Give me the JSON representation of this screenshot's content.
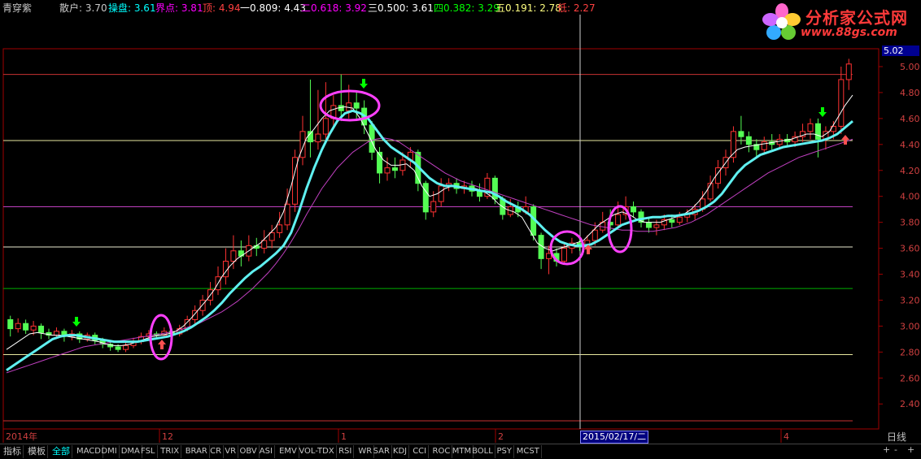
{
  "top_bar": {
    "title": "青穿紫",
    "items": [
      {
        "label": "散户:",
        "value": "3.70",
        "color": "#c8c8c8"
      },
      {
        "label": "操盘:",
        "value": "3.61",
        "color": "#00ffff"
      },
      {
        "label": "界点:",
        "value": "3.81",
        "color": "#ff00ff"
      },
      {
        "label": "顶:",
        "value": "4.94",
        "color": "#ff4040"
      },
      {
        "label": "一0.809:",
        "value": "4.43",
        "color": "#ffffff"
      },
      {
        "label": "二0.618:",
        "value": "3.92",
        "color": "#ff00ff"
      },
      {
        "label": "三0.500:",
        "value": "3.61",
        "color": "#ffffff"
      },
      {
        "label": "四0.382:",
        "value": "3.29",
        "color": "#00ff00"
      },
      {
        "label": "五0.191:",
        "value": "2.78",
        "color": "#ffff80"
      },
      {
        "label": "低:",
        "value": "2.27",
        "color": "#ff4040"
      }
    ]
  },
  "logo": {
    "name": "分析家公式网",
    "url": "www.88gs.com"
  },
  "price_box": "5.02",
  "crosshair_date": "2015/02/17/二",
  "period": "日线",
  "x_labels": [
    "2014年",
    "12",
    "1",
    "2",
    "4"
  ],
  "y_ticks": [
    "5.00",
    "4.80",
    "4.60",
    "4.40",
    "4.20",
    "4.00",
    "3.80",
    "3.60",
    "3.40",
    "3.20",
    "3.00",
    "2.80",
    "2.60",
    "2.40"
  ],
  "tabs": [
    "指标",
    "模板",
    "全部",
    "MACD",
    "DMI",
    "DMA",
    "FSL",
    "TRIX",
    "BRAR",
    "CR",
    "VR",
    "OBV",
    "ASI",
    "EMV",
    "VOL-TDX",
    "RSI",
    "WR",
    "SAR",
    "KDJ",
    "CCI",
    "ROC",
    "MTM",
    "BOLL",
    "PSY",
    "MCST"
  ],
  "scroll_buttons": [
    "+",
    "-",
    "+"
  ],
  "colors": {
    "up": "#ff3232",
    "down": "#54fcfc",
    "green": "#00a000",
    "cyan_line": "#5ff0f0",
    "magenta_line": "#c040c0",
    "axis": "#a00000"
  },
  "chart_data": {
    "type": "candlestick",
    "y_range": [
      2.27,
      5.05
    ],
    "horizontal_levels": [
      {
        "value": 4.94,
        "color": "#c83232"
      },
      {
        "value": 4.43,
        "color": "#e8e8a0"
      },
      {
        "value": 3.92,
        "color": "#c040c0"
      },
      {
        "value": 3.61,
        "color": "#e8e8d0"
      },
      {
        "value": 3.29,
        "color": "#00b000"
      },
      {
        "value": 2.78,
        "color": "#e8e8a0"
      },
      {
        "value": 2.27,
        "color": "#c83232"
      }
    ],
    "candles": [
      [
        3.05,
        2.98,
        3.08,
        2.92
      ],
      [
        2.98,
        3.02,
        3.06,
        2.95
      ],
      [
        3.02,
        2.97,
        3.05,
        2.94
      ],
      [
        2.97,
        3.0,
        3.04,
        2.93
      ],
      [
        3.0,
        2.95,
        3.02,
        2.9
      ],
      [
        2.95,
        2.93,
        2.98,
        2.9
      ],
      [
        2.93,
        2.96,
        2.99,
        2.9
      ],
      [
        2.96,
        2.92,
        2.98,
        2.88
      ],
      [
        2.92,
        2.94,
        2.97,
        2.89
      ],
      [
        2.94,
        2.9,
        2.96,
        2.87
      ],
      [
        2.9,
        2.93,
        2.95,
        2.88
      ],
      [
        2.93,
        2.89,
        2.95,
        2.86
      ],
      [
        2.89,
        2.86,
        2.91,
        2.83
      ],
      [
        2.86,
        2.84,
        2.88,
        2.81
      ],
      [
        2.84,
        2.82,
        2.86,
        2.8
      ],
      [
        2.82,
        2.85,
        2.88,
        2.8
      ],
      [
        2.85,
        2.88,
        2.91,
        2.83
      ],
      [
        2.88,
        2.92,
        2.95,
        2.86
      ],
      [
        2.92,
        2.94,
        2.97,
        2.9
      ],
      [
        2.94,
        2.93,
        2.96,
        2.91
      ],
      [
        2.93,
        2.96,
        2.99,
        2.91
      ],
      [
        2.96,
        2.94,
        2.98,
        2.92
      ],
      [
        2.94,
        2.98,
        3.01,
        2.92
      ],
      [
        2.98,
        3.05,
        3.08,
        2.96
      ],
      [
        3.05,
        3.12,
        3.16,
        3.02
      ],
      [
        3.12,
        3.2,
        3.24,
        3.08
      ],
      [
        3.2,
        3.28,
        3.34,
        3.16
      ],
      [
        3.28,
        3.38,
        3.46,
        3.24
      ],
      [
        3.38,
        3.5,
        3.6,
        3.32
      ],
      [
        3.5,
        3.58,
        3.7,
        3.44
      ],
      [
        3.58,
        3.54,
        3.66,
        3.46
      ],
      [
        3.54,
        3.62,
        3.7,
        3.5
      ],
      [
        3.62,
        3.6,
        3.68,
        3.54
      ],
      [
        3.6,
        3.66,
        3.74,
        3.56
      ],
      [
        3.66,
        3.72,
        3.78,
        3.6
      ],
      [
        3.72,
        3.78,
        3.88,
        3.68
      ],
      [
        3.78,
        3.94,
        4.06,
        3.74
      ],
      [
        3.94,
        4.3,
        4.36,
        3.88
      ],
      [
        4.3,
        4.5,
        4.62,
        4.24
      ],
      [
        4.5,
        4.42,
        4.9,
        4.3
      ],
      [
        4.42,
        4.48,
        4.82,
        4.36
      ],
      [
        4.48,
        4.6,
        4.88,
        4.44
      ],
      [
        4.6,
        4.7,
        4.78,
        4.52
      ],
      [
        4.7,
        4.66,
        4.94,
        4.58
      ],
      [
        4.66,
        4.72,
        4.86,
        4.6
      ],
      [
        4.72,
        4.68,
        4.8,
        4.6
      ],
      [
        4.68,
        4.55,
        4.74,
        4.48
      ],
      [
        4.55,
        4.34,
        4.58,
        4.28
      ],
      [
        4.34,
        4.18,
        4.38,
        4.1
      ],
      [
        4.18,
        4.22,
        4.3,
        4.12
      ],
      [
        4.22,
        4.2,
        4.3,
        4.14
      ],
      [
        4.2,
        4.28,
        4.34,
        4.16
      ],
      [
        4.28,
        4.34,
        4.38,
        4.22
      ],
      [
        4.34,
        4.1,
        4.36,
        4.04
      ],
      [
        4.1,
        3.88,
        4.12,
        3.82
      ],
      [
        3.88,
        3.96,
        4.04,
        3.84
      ],
      [
        3.96,
        4.08,
        4.14,
        3.92
      ],
      [
        4.08,
        4.1,
        4.14,
        4.04
      ],
      [
        4.1,
        4.06,
        4.14,
        4.02
      ],
      [
        4.06,
        4.08,
        4.12,
        4.02
      ],
      [
        4.08,
        4.04,
        4.12,
        4.0
      ],
      [
        4.04,
        4.0,
        4.1,
        3.96
      ],
      [
        4.0,
        4.14,
        4.18,
        3.98
      ],
      [
        4.14,
        3.98,
        4.16,
        3.94
      ],
      [
        3.98,
        3.86,
        4.0,
        3.82
      ],
      [
        3.86,
        3.92,
        3.98,
        3.84
      ],
      [
        3.92,
        3.88,
        3.96,
        3.84
      ],
      [
        3.88,
        3.92,
        4.0,
        3.86
      ],
      [
        3.92,
        3.7,
        3.94,
        3.66
      ],
      [
        3.7,
        3.52,
        3.72,
        3.44
      ],
      [
        3.52,
        3.56,
        3.62,
        3.4
      ],
      [
        3.56,
        3.5,
        3.6,
        3.46
      ],
      [
        3.5,
        3.6,
        3.64,
        3.48
      ],
      [
        3.6,
        3.64,
        3.68,
        3.56
      ],
      [
        3.64,
        3.62,
        3.68,
        3.58
      ],
      [
        3.62,
        3.66,
        3.7,
        3.6
      ],
      [
        3.66,
        3.74,
        3.8,
        3.62
      ],
      [
        3.74,
        3.8,
        3.88,
        3.72
      ],
      [
        3.8,
        3.78,
        3.9,
        3.74
      ],
      [
        3.78,
        3.86,
        3.96,
        3.76
      ],
      [
        3.86,
        3.92,
        4.0,
        3.82
      ],
      [
        3.92,
        3.88,
        3.96,
        3.84
      ],
      [
        3.88,
        3.8,
        3.9,
        3.76
      ],
      [
        3.8,
        3.76,
        3.84,
        3.72
      ],
      [
        3.76,
        3.78,
        3.82,
        3.7
      ],
      [
        3.78,
        3.82,
        3.86,
        3.74
      ],
      [
        3.82,
        3.8,
        3.86,
        3.76
      ],
      [
        3.8,
        3.84,
        3.88,
        3.78
      ],
      [
        3.84,
        3.86,
        3.9,
        3.8
      ],
      [
        3.86,
        3.9,
        3.94,
        3.82
      ],
      [
        3.9,
        3.98,
        4.04,
        3.88
      ],
      [
        3.98,
        4.1,
        4.16,
        3.96
      ],
      [
        4.1,
        4.22,
        4.28,
        4.06
      ],
      [
        4.22,
        4.3,
        4.36,
        4.16
      ],
      [
        4.3,
        4.5,
        4.54,
        4.26
      ],
      [
        4.5,
        4.46,
        4.62,
        4.4
      ],
      [
        4.46,
        4.4,
        4.5,
        4.34
      ],
      [
        4.4,
        4.36,
        4.44,
        4.3
      ],
      [
        4.36,
        4.42,
        4.46,
        4.32
      ],
      [
        4.42,
        4.4,
        4.48,
        4.36
      ],
      [
        4.4,
        4.44,
        4.48,
        4.36
      ],
      [
        4.44,
        4.42,
        4.48,
        4.38
      ],
      [
        4.42,
        4.46,
        4.5,
        4.38
      ],
      [
        4.46,
        4.5,
        4.56,
        4.42
      ],
      [
        4.5,
        4.56,
        4.6,
        4.44
      ],
      [
        4.56,
        4.44,
        4.6,
        4.3
      ],
      [
        4.44,
        4.5,
        4.54,
        4.36
      ],
      [
        4.5,
        4.54,
        4.58,
        4.44
      ],
      [
        4.54,
        4.9,
        5.0,
        4.48
      ],
      [
        4.9,
        5.02,
        5.06,
        4.82
      ]
    ],
    "cyan_ma": [
      2.66,
      2.7,
      2.74,
      2.78,
      2.82,
      2.86,
      2.9,
      2.92,
      2.93,
      2.93,
      2.92,
      2.91,
      2.9,
      2.89,
      2.88,
      2.88,
      2.88,
      2.88,
      2.89,
      2.9,
      2.91,
      2.92,
      2.94,
      2.96,
      2.99,
      3.03,
      3.07,
      3.12,
      3.18,
      3.25,
      3.31,
      3.37,
      3.42,
      3.46,
      3.51,
      3.56,
      3.62,
      3.72,
      3.88,
      4.06,
      4.22,
      4.36,
      4.48,
      4.58,
      4.64,
      4.66,
      4.64,
      4.6,
      4.52,
      4.44,
      4.38,
      4.34,
      4.3,
      4.26,
      4.2,
      4.14,
      4.1,
      4.08,
      4.08,
      4.07,
      4.06,
      4.05,
      4.04,
      4.03,
      4.0,
      3.96,
      3.93,
      3.9,
      3.86,
      3.8,
      3.74,
      3.69,
      3.65,
      3.63,
      3.62,
      3.62,
      3.63,
      3.66,
      3.7,
      3.74,
      3.78,
      3.8,
      3.82,
      3.83,
      3.84,
      3.84,
      3.85,
      3.85,
      3.86,
      3.87,
      3.89,
      3.92,
      3.96,
      4.02,
      4.1,
      4.18,
      4.24,
      4.28,
      4.32,
      4.34,
      4.36,
      4.38,
      4.39,
      4.4,
      4.41,
      4.42,
      4.43,
      4.45,
      4.48,
      4.53,
      4.58
    ],
    "white_ma": [
      2.82,
      2.86,
      2.9,
      2.94,
      2.95,
      2.94,
      2.93,
      2.93,
      2.92,
      2.91,
      2.9,
      2.89,
      2.88,
      2.86,
      2.85,
      2.85,
      2.86,
      2.88,
      2.9,
      2.92,
      2.93,
      2.94,
      2.96,
      3.0,
      3.06,
      3.13,
      3.2,
      3.28,
      3.38,
      3.46,
      3.52,
      3.56,
      3.6,
      3.64,
      3.7,
      3.76,
      3.88,
      4.08,
      4.3,
      4.45,
      4.52,
      4.6,
      4.66,
      4.68,
      4.69,
      4.68,
      4.6,
      4.48,
      4.36,
      4.28,
      4.24,
      4.24,
      4.25,
      4.2,
      4.08,
      4.0,
      4.02,
      4.06,
      4.08,
      4.07,
      4.06,
      4.06,
      4.04,
      4.0,
      3.94,
      3.9,
      3.88,
      3.84,
      3.74,
      3.64,
      3.6,
      3.58,
      3.6,
      3.62,
      3.64,
      3.66,
      3.72,
      3.78,
      3.82,
      3.86,
      3.88,
      3.86,
      3.82,
      3.8,
      3.8,
      3.8,
      3.82,
      3.84,
      3.86,
      3.9,
      3.96,
      4.04,
      4.14,
      4.22,
      4.3,
      4.36,
      4.38,
      4.39,
      4.4,
      4.41,
      4.42,
      4.43,
      4.44,
      4.46,
      4.48,
      4.48,
      4.46,
      4.5,
      4.6,
      4.7,
      4.78
    ],
    "magenta_ma": [
      2.64,
      2.66,
      2.68,
      2.7,
      2.72,
      2.74,
      2.76,
      2.78,
      2.8,
      2.82,
      2.84,
      2.85,
      2.86,
      2.87,
      2.88,
      2.89,
      2.9,
      2.91,
      2.92,
      2.93,
      2.94,
      2.95,
      2.96,
      2.98,
      3.0,
      3.02,
      3.05,
      3.08,
      3.11,
      3.15,
      3.19,
      3.24,
      3.29,
      3.35,
      3.41,
      3.48,
      3.56,
      3.65,
      3.75,
      3.86,
      3.96,
      4.06,
      4.14,
      4.22,
      4.28,
      4.34,
      4.38,
      4.42,
      4.44,
      4.45,
      4.44,
      4.42,
      4.38,
      4.34,
      4.3,
      4.26,
      4.22,
      4.18,
      4.15,
      4.12,
      4.1,
      4.08,
      4.06,
      4.04,
      4.02,
      4.0,
      3.98,
      3.96,
      3.94,
      3.92,
      3.9,
      3.88,
      3.86,
      3.84,
      3.82,
      3.8,
      3.78,
      3.77,
      3.76,
      3.75,
      3.74,
      3.74,
      3.73,
      3.73,
      3.73,
      3.74,
      3.75,
      3.76,
      3.78,
      3.8,
      3.83,
      3.86,
      3.9,
      3.94,
      3.98,
      4.02,
      4.06,
      4.1,
      4.14,
      4.18,
      4.21,
      4.24,
      4.27,
      4.3,
      4.32,
      4.34,
      4.36,
      4.38,
      4.4,
      4.42,
      4.44
    ]
  }
}
